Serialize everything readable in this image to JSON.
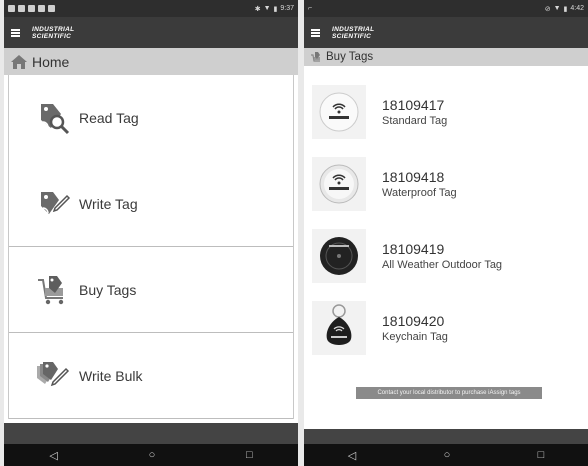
{
  "left": {
    "status_time": "9:37",
    "logo_line1": "INDUSTRIAL",
    "logo_line2": "SCIENTIFIC",
    "breadcrumb": "Home",
    "menu": [
      {
        "label": "Read Tag",
        "icon": "read-tag-icon"
      },
      {
        "label": "Write Tag",
        "icon": "write-tag-icon"
      },
      {
        "label": "Buy Tags",
        "icon": "buy-tags-icon"
      },
      {
        "label": "Write Bulk",
        "icon": "write-bulk-icon"
      }
    ]
  },
  "right": {
    "status_time": "4:42",
    "logo_line1": "INDUSTRIAL",
    "logo_line2": "SCIENTIFIC",
    "breadcrumb": "Buy Tags",
    "tags": [
      {
        "number": "18109417",
        "description": "Standard Tag",
        "icon": "standard-tag-image"
      },
      {
        "number": "18109418",
        "description": "Waterproof Tag",
        "icon": "waterproof-tag-image"
      },
      {
        "number": "18109419",
        "description": "All Weather Outdoor Tag",
        "icon": "all-weather-tag-image"
      },
      {
        "number": "18109420",
        "description": "Keychain Tag",
        "icon": "keychain-tag-image"
      }
    ],
    "toast": "Contact your local distributor to purchase iAssign tags"
  },
  "navbar": {
    "back": "◁",
    "home": "○",
    "recents": "□"
  },
  "colors": {
    "statusbar": "#2e2e2e",
    "appbar": "#3b3b3b",
    "breadcrumb": "#cfcfcf",
    "navbar": "#111111"
  }
}
